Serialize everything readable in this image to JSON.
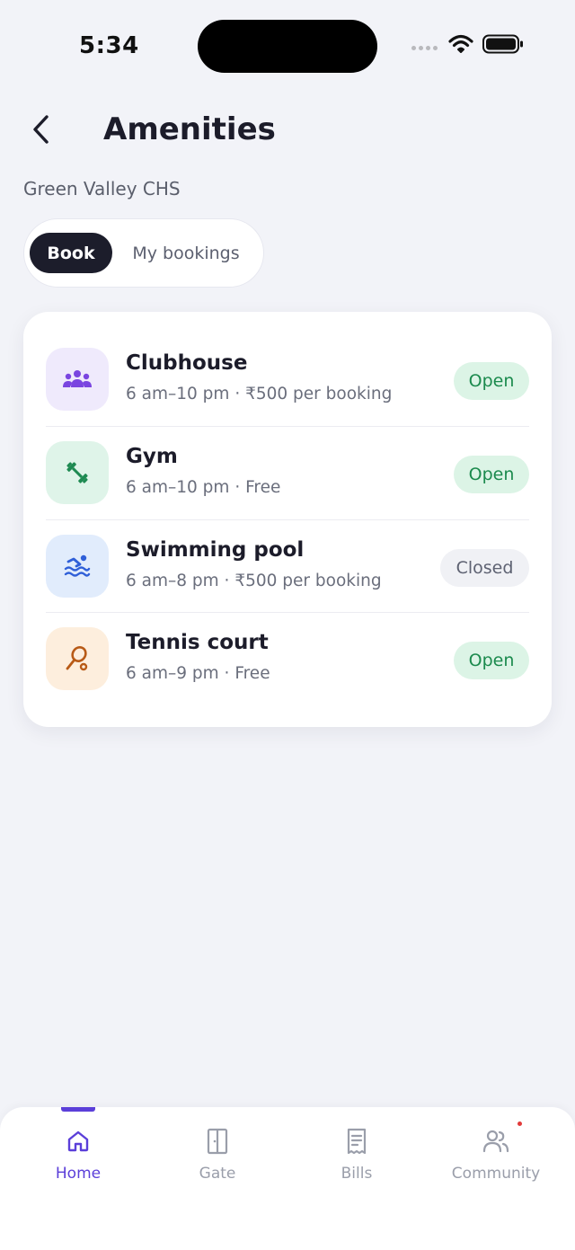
{
  "status_bar": {
    "time": "5:34"
  },
  "header": {
    "title": "Amenities",
    "back_icon": "chevron-left-icon"
  },
  "society": {
    "name": "Green Valley CHS"
  },
  "segmented": {
    "book_label": "Book",
    "my_bookings_label": "My bookings",
    "selected": "Book"
  },
  "amenities": [
    {
      "name": "Clubhouse",
      "meta": "6 am–10 pm · ₹500 per booking",
      "status": "Open",
      "icon": "group-icon",
      "icon_bg": "#efeafc",
      "icon_color": "#7a45e0"
    },
    {
      "name": "Gym",
      "meta": "6 am–10 pm · Free",
      "status": "Open",
      "icon": "dumbbell-icon",
      "icon_bg": "#dff4e9",
      "icon_color": "#1e8a52"
    },
    {
      "name": "Swimming pool",
      "meta": "6 am–8 pm · ₹500 per booking",
      "status": "Closed",
      "icon": "swimmer-icon",
      "icon_bg": "#e1ecfc",
      "icon_color": "#2f5fd8"
    },
    {
      "name": "Tennis court",
      "meta": "6 am–9 pm · Free",
      "status": "Open",
      "icon": "racket-icon",
      "icon_bg": "#fdeedd",
      "icon_color": "#b85a16"
    }
  ],
  "colors": {
    "accent": "#5b3fd9",
    "open_bg": "#dcf4e6",
    "open_text": "#1b8a4d",
    "closed_bg": "#f0f1f5",
    "closed_text": "#5e6272"
  },
  "tabbar": {
    "items": [
      {
        "label": "Home",
        "icon": "home-icon",
        "active": true
      },
      {
        "label": "Gate",
        "icon": "door-icon",
        "active": false
      },
      {
        "label": "Bills",
        "icon": "receipt-icon",
        "active": false
      },
      {
        "label": "Community",
        "icon": "people-icon",
        "active": false,
        "has_notification": true
      }
    ]
  }
}
